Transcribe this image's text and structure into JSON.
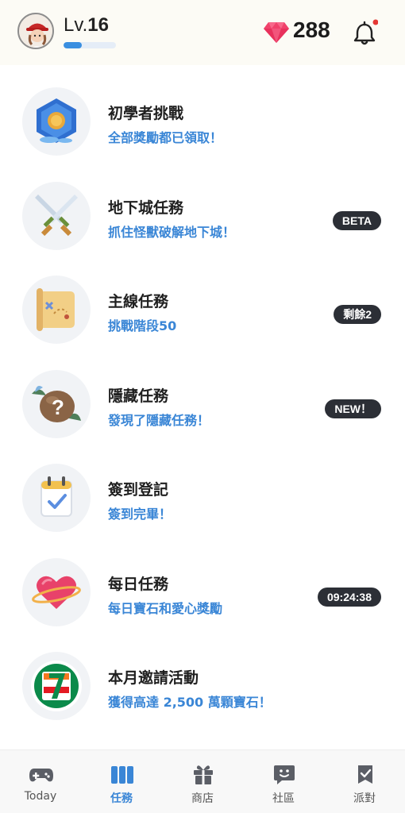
{
  "header": {
    "level_prefix": "Lv.",
    "level_value": "16",
    "level_progress": 0.35,
    "gems": "288",
    "notification_dot": true
  },
  "tasks": [
    {
      "title": "初學者挑戰",
      "subtitle": "全部獎勵都已領取！",
      "icon": "beginner-gem-icon",
      "badge": ""
    },
    {
      "title": "地下城任務",
      "subtitle": "抓住怪獸破解地下城！",
      "icon": "crossed-swords-icon",
      "badge": "BETA"
    },
    {
      "title": "主線任務",
      "subtitle": "挑戰階段50",
      "icon": "treasure-map-icon",
      "badge": "剩餘2"
    },
    {
      "title": "隱藏任務",
      "subtitle": "發現了隱藏任務！",
      "icon": "mystery-egg-icon",
      "badge": "NEW！"
    },
    {
      "title": "簽到登記",
      "subtitle": "簽到完畢！",
      "icon": "calendar-check-icon",
      "badge": ""
    },
    {
      "title": "每日任務",
      "subtitle": "每日寶石和愛心獎勵",
      "icon": "heart-planet-icon",
      "badge": "09:24:38"
    },
    {
      "title": "本月邀請活動",
      "subtitle": "獲得高達 2,500 萬顆寶石！",
      "icon": "seven-eleven-logo",
      "badge": ""
    }
  ],
  "nav": [
    {
      "label": "Today",
      "icon": "gamepad-icon",
      "active": false
    },
    {
      "label": "任務",
      "icon": "tasks-icon",
      "active": true
    },
    {
      "label": "商店",
      "icon": "gift-icon",
      "active": false
    },
    {
      "label": "社區",
      "icon": "chat-smile-icon",
      "active": false
    },
    {
      "label": "派對",
      "icon": "party-flag-icon",
      "active": false
    }
  ],
  "colors": {
    "accent": "#3a86d6",
    "badge_bg": "#2c2f36",
    "gem": "#f0426b",
    "notification": "#e53935"
  }
}
